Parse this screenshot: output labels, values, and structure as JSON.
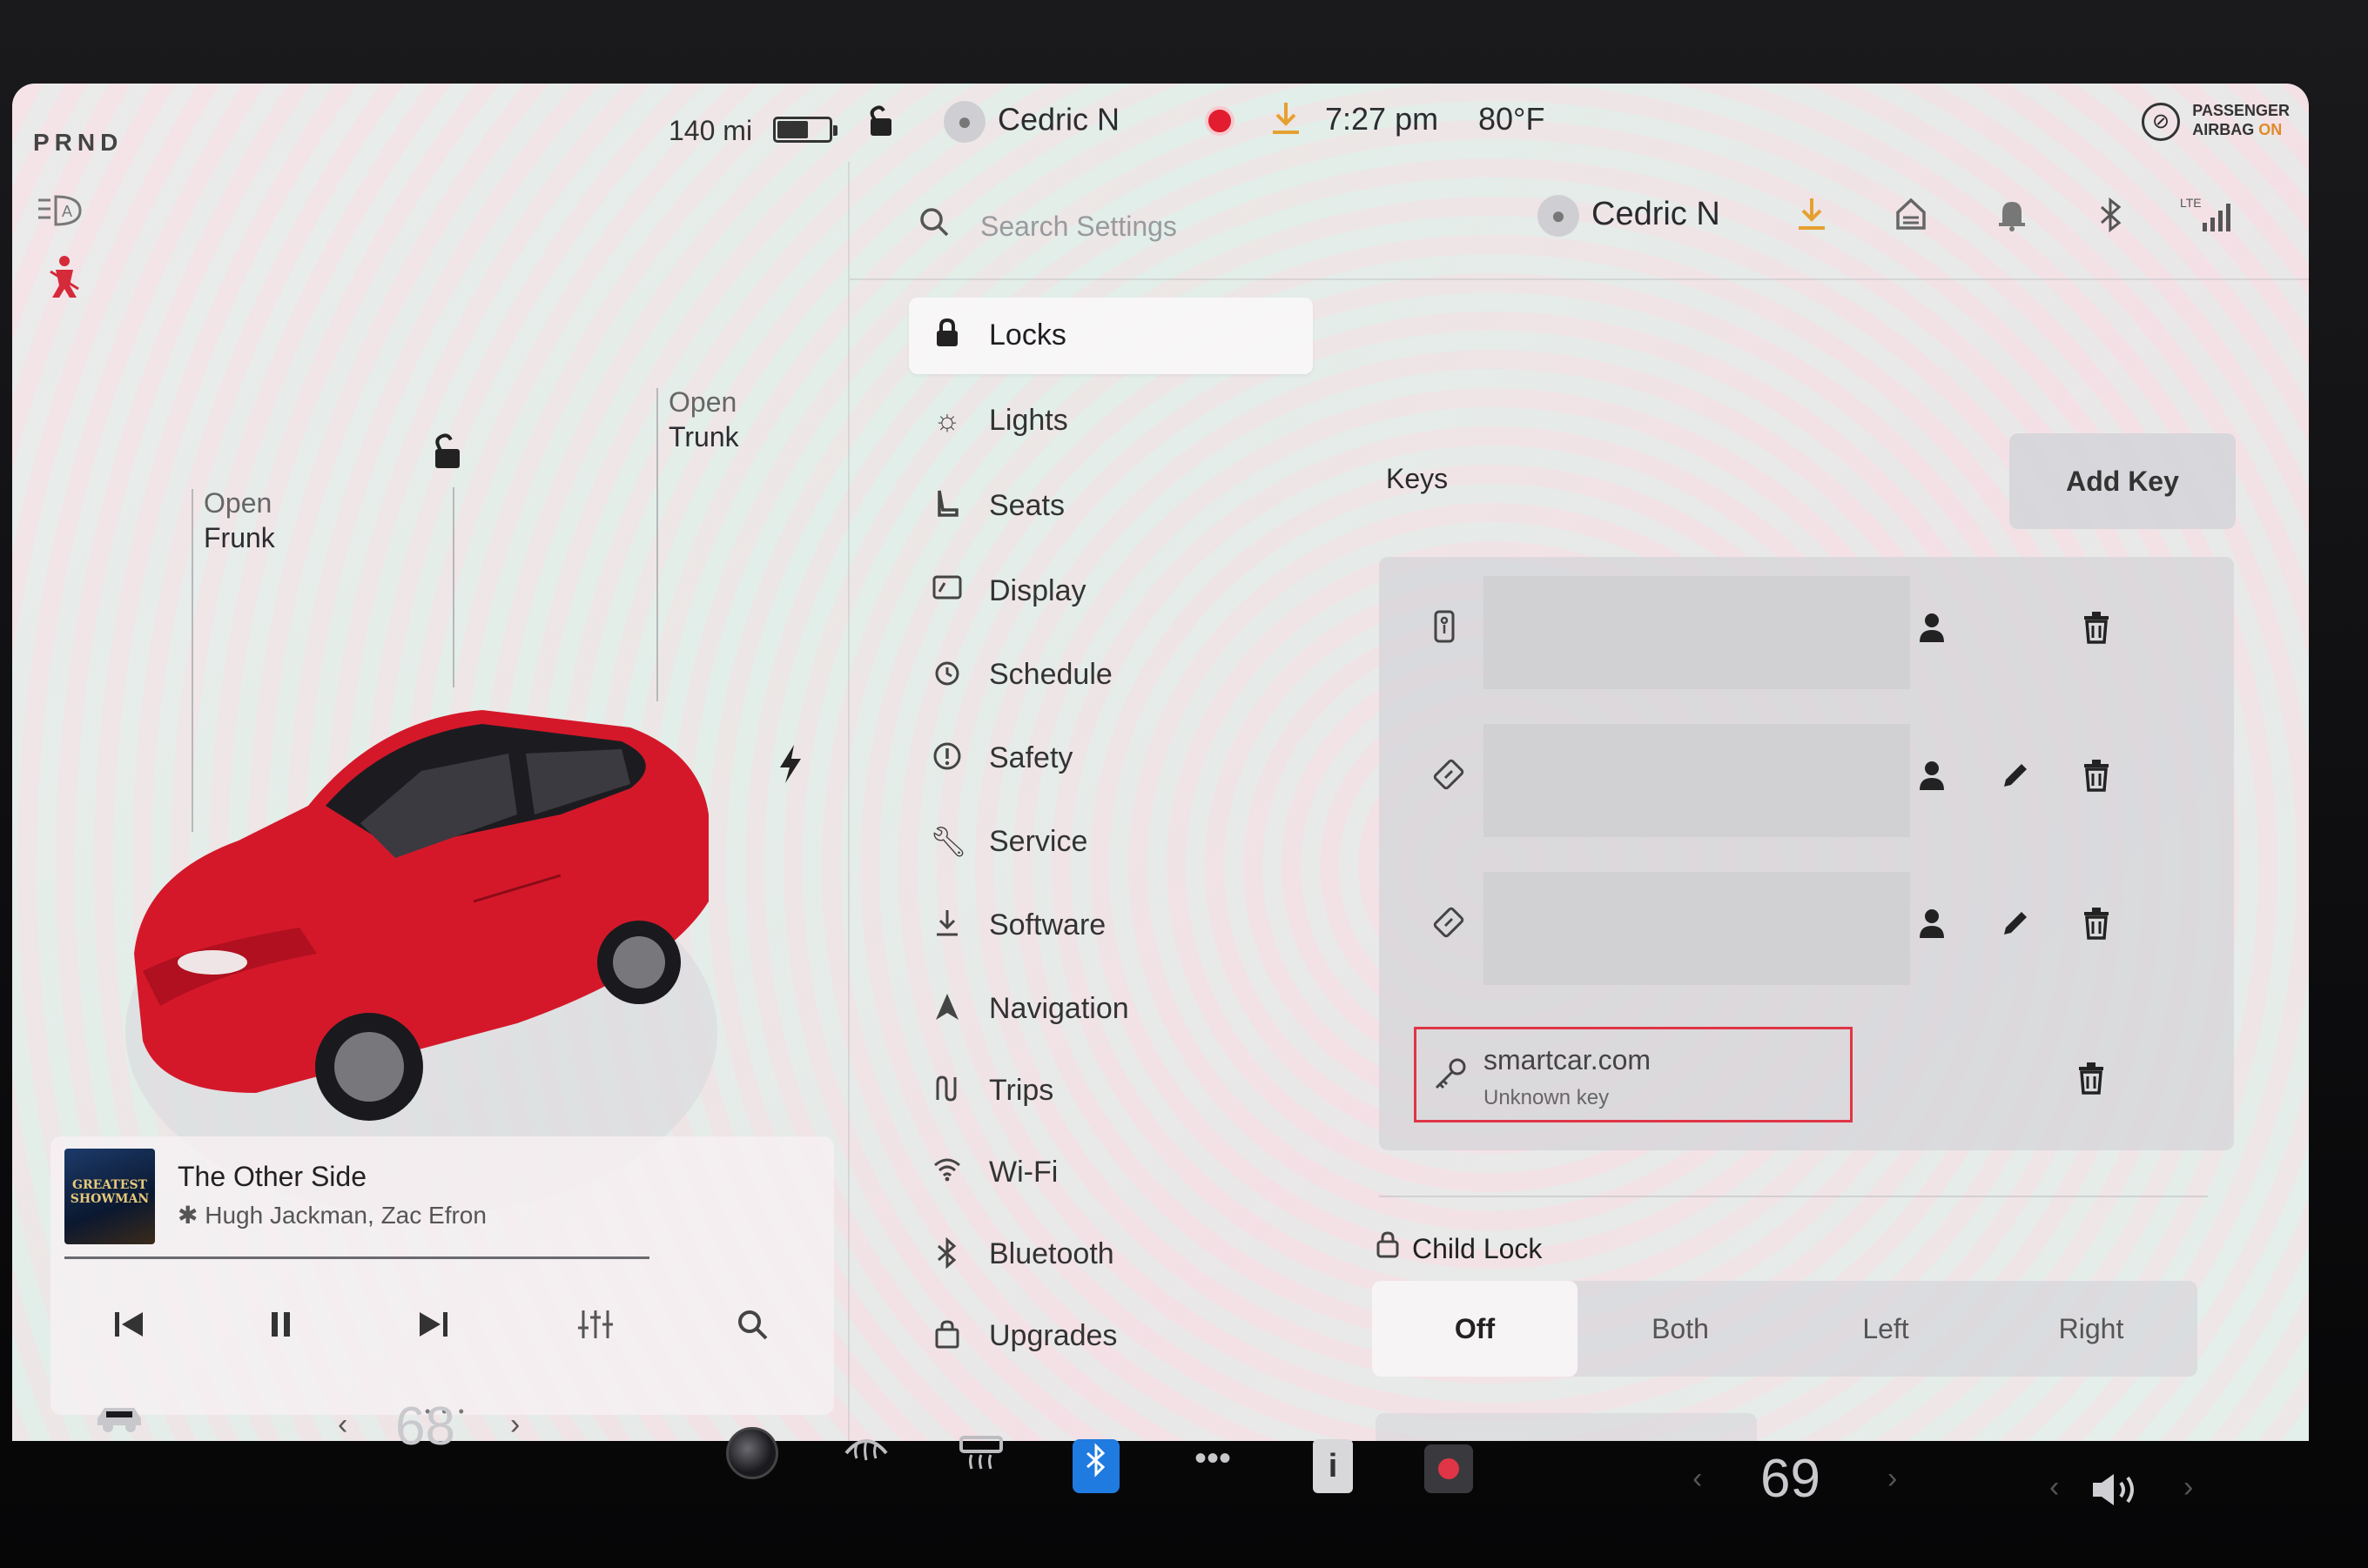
{
  "left_panel": {
    "gear": "PRND",
    "range": "140 mi",
    "battery_level": 0.6,
    "car_labels": {
      "frunk_line1": "Open",
      "frunk_line2": "Frunk",
      "trunk_line1": "Open",
      "trunk_line2": "Trunk"
    },
    "car_color": "#d4182a"
  },
  "media": {
    "album_art_text": "GREATEST SHOWMAN",
    "song": "The Other Side",
    "artist": "Hugh Jackman, Zac Efron",
    "progress": 0.8
  },
  "status_bar": {
    "driver": "Cedric N",
    "time": "7:27 pm",
    "temperature": "80°F",
    "airbag_line1": "PASSENGER",
    "airbag_line2_prefix": "AIRBAG ",
    "airbag_line2_state": "ON"
  },
  "settings_header": {
    "search_placeholder": "Search Settings",
    "profile_name": "Cedric N",
    "signal_label": "LTE"
  },
  "menu": {
    "items": [
      {
        "label": "Locks",
        "icon": "lock-icon"
      },
      {
        "label": "Lights",
        "icon": "sun-icon"
      },
      {
        "label": "Seats",
        "icon": "seat-icon"
      },
      {
        "label": "Display",
        "icon": "display-icon"
      },
      {
        "label": "Schedule",
        "icon": "clock-icon"
      },
      {
        "label": "Safety",
        "icon": "alert-icon"
      },
      {
        "label": "Service",
        "icon": "wrench-icon"
      },
      {
        "label": "Software",
        "icon": "download-icon"
      },
      {
        "label": "Navigation",
        "icon": "navigation-icon"
      },
      {
        "label": "Trips",
        "icon": "trips-icon"
      },
      {
        "label": "Wi-Fi",
        "icon": "wifi-icon"
      },
      {
        "label": "Bluetooth",
        "icon": "bluetooth-icon"
      },
      {
        "label": "Upgrades",
        "icon": "bag-icon"
      }
    ],
    "active": "Locks"
  },
  "keys": {
    "title": "Keys",
    "add_button": "Add Key",
    "entries": [
      {
        "type": "key-fob",
        "name": "",
        "actions": [
          "driver-profile",
          "delete"
        ]
      },
      {
        "type": "key-card",
        "name": "",
        "actions": [
          "driver-profile",
          "edit",
          "delete"
        ]
      },
      {
        "type": "key-card",
        "name": "",
        "actions": [
          "driver-profile",
          "edit",
          "delete"
        ]
      },
      {
        "type": "third-party",
        "name": "smartcar.com",
        "subtitle": "Unknown key",
        "actions": [
          "delete"
        ]
      }
    ],
    "highlight_color": "#e03546"
  },
  "child_lock": {
    "title": "Child Lock",
    "options": [
      "Off",
      "Both",
      "Left",
      "Right"
    ],
    "selected": "Off"
  },
  "dock": {
    "driver_temp": "68",
    "passenger_temp": "69",
    "bluetooth_color": "#1f7be0"
  }
}
